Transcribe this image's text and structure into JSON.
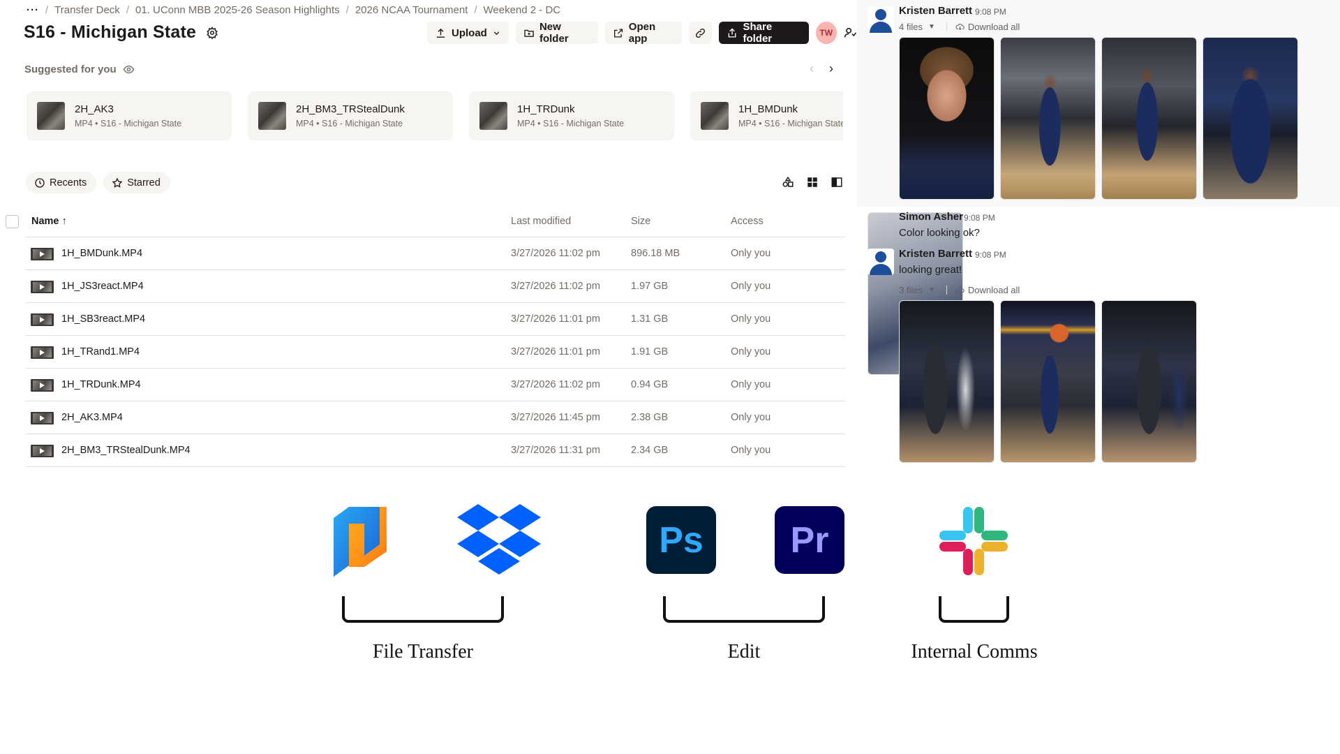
{
  "breadcrumb": {
    "more": "···",
    "items": [
      "Transfer Deck",
      "01. UConn MBB 2025-26 Season Highlights",
      "2026 NCAA Tournament",
      "Weekend 2 - DC"
    ]
  },
  "page_title": "S16 - Michigan State",
  "toolbar": {
    "upload": "Upload",
    "new_folder": "New folder",
    "open_app": "Open app",
    "share_folder": "Share folder",
    "avatar_initials": "TW"
  },
  "suggested": {
    "label": "Suggested for you",
    "cards": [
      {
        "name": "2H_AK3",
        "meta": "MP4 • S16 - Michigan State"
      },
      {
        "name": "2H_BM3_TRStealDunk",
        "meta": "MP4 • S16 - Michigan State"
      },
      {
        "name": "1H_TRDunk",
        "meta": "MP4 • S16 - Michigan State"
      },
      {
        "name": "1H_BMDunk",
        "meta": "MP4 • S16 - Michigan State"
      }
    ]
  },
  "filters": {
    "recents": "Recents",
    "starred": "Starred"
  },
  "table": {
    "headers": {
      "name": "Name",
      "modified": "Last modified",
      "size": "Size",
      "access": "Access"
    },
    "rows": [
      {
        "name": "1H_BMDunk.MP4",
        "modified": "3/27/2026 11:02 pm",
        "size": "896.18 MB",
        "access": "Only you"
      },
      {
        "name": "1H_JS3react.MP4",
        "modified": "3/27/2026 11:02 pm",
        "size": "1.97 GB",
        "access": "Only you"
      },
      {
        "name": "1H_SB3react.MP4",
        "modified": "3/27/2026 11:01 pm",
        "size": "1.31 GB",
        "access": "Only you"
      },
      {
        "name": "1H_TRand1.MP4",
        "modified": "3/27/2026 11:01 pm",
        "size": "1.91 GB",
        "access": "Only you"
      },
      {
        "name": "1H_TRDunk.MP4",
        "modified": "3/27/2026 11:02 pm",
        "size": "0.94 GB",
        "access": "Only you"
      },
      {
        "name": "2H_AK3.MP4",
        "modified": "3/27/2026 11:45 pm",
        "size": "2.38 GB",
        "access": "Only you"
      },
      {
        "name": "2H_BM3_TRStealDunk.MP4",
        "modified": "3/27/2026 11:31 pm",
        "size": "2.34 GB",
        "access": "Only you"
      }
    ]
  },
  "slack": {
    "messages": [
      {
        "author": "Kristen Barrett",
        "time": "9:08 PM",
        "files_label": "4 files",
        "download_label": "Download all"
      },
      {
        "author": "Simon Asher",
        "time": "9:08 PM",
        "text": "Color looking ok?"
      },
      {
        "author": "Kristen Barrett",
        "time": "9:08 PM",
        "text": "looking great!",
        "files_label": "3 files",
        "download_label": "Download all"
      }
    ]
  },
  "workflow": {
    "groups": [
      {
        "caption": "File Transfer",
        "apps": [
          "transfer-app-icon",
          "dropbox-icon"
        ]
      },
      {
        "caption": "Edit",
        "apps": [
          "Ps",
          "Pr"
        ]
      },
      {
        "caption": "Internal Comms",
        "apps": [
          "slack-icon"
        ]
      }
    ]
  },
  "colors": {
    "dropbox_blue": "#0061fe",
    "photoshop_bg": "#001e36",
    "photoshop_fg": "#31a8ff",
    "premiere_bg": "#00005b",
    "premiere_fg": "#9999ff",
    "share_button": "#1e1919",
    "avatar_bg": "#fbb4af"
  }
}
